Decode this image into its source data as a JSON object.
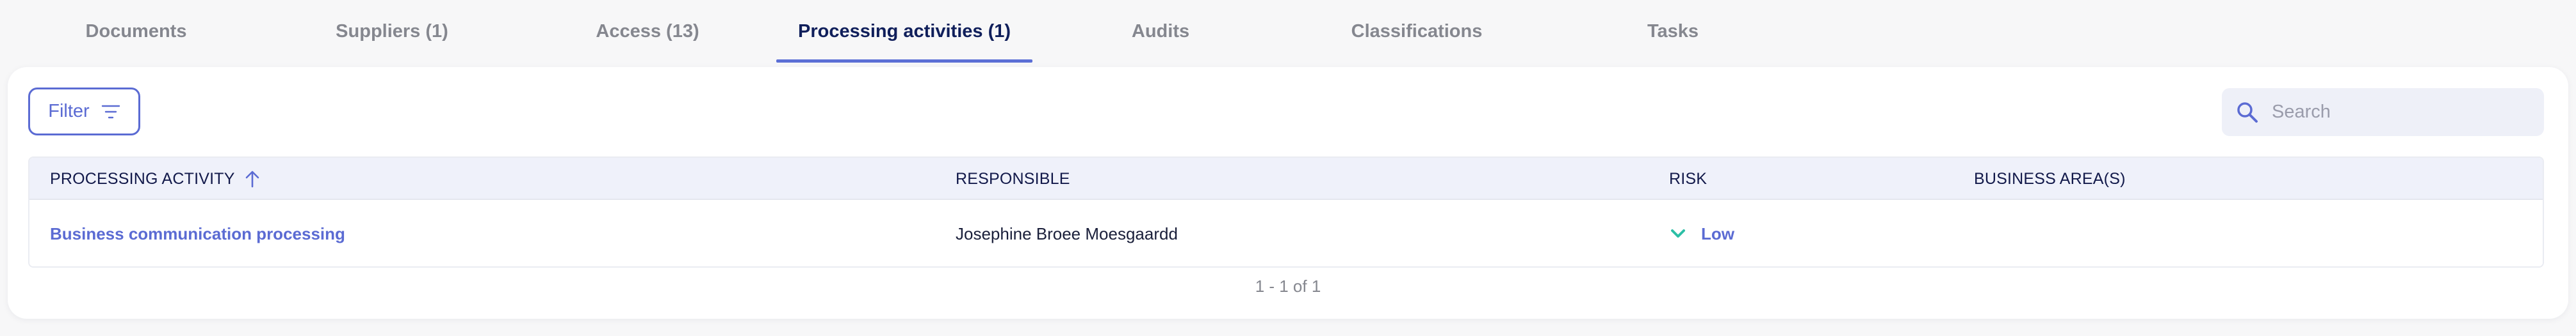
{
  "tabs": [
    {
      "label": "Documents"
    },
    {
      "label": "Suppliers (1)"
    },
    {
      "label": "Access (13)"
    },
    {
      "label": "Processing activities (1)"
    },
    {
      "label": "Audits"
    },
    {
      "label": "Classifications"
    },
    {
      "label": "Tasks"
    }
  ],
  "active_tab": "Processing activities (1)",
  "toolbar": {
    "filter_label": "Filter",
    "search_placeholder": "Search"
  },
  "table": {
    "columns": [
      {
        "label": "PROCESSING ACTIVITY",
        "sorted": "asc"
      },
      {
        "label": "RESPONSIBLE"
      },
      {
        "label": "RISK"
      },
      {
        "label": "BUSINESS AREA(S)"
      }
    ],
    "rows": [
      {
        "processing_activity": "Business communication processing",
        "responsible": "Josephine Broee Moesgaardd",
        "risk": "Low",
        "business_areas": ""
      }
    ]
  },
  "pagination": {
    "text": "1 - 1 of 1"
  },
  "colors": {
    "accent": "#5b6bd3",
    "active_tab_text": "#101f5b",
    "risk_low_icon": "#2cbfa6"
  }
}
